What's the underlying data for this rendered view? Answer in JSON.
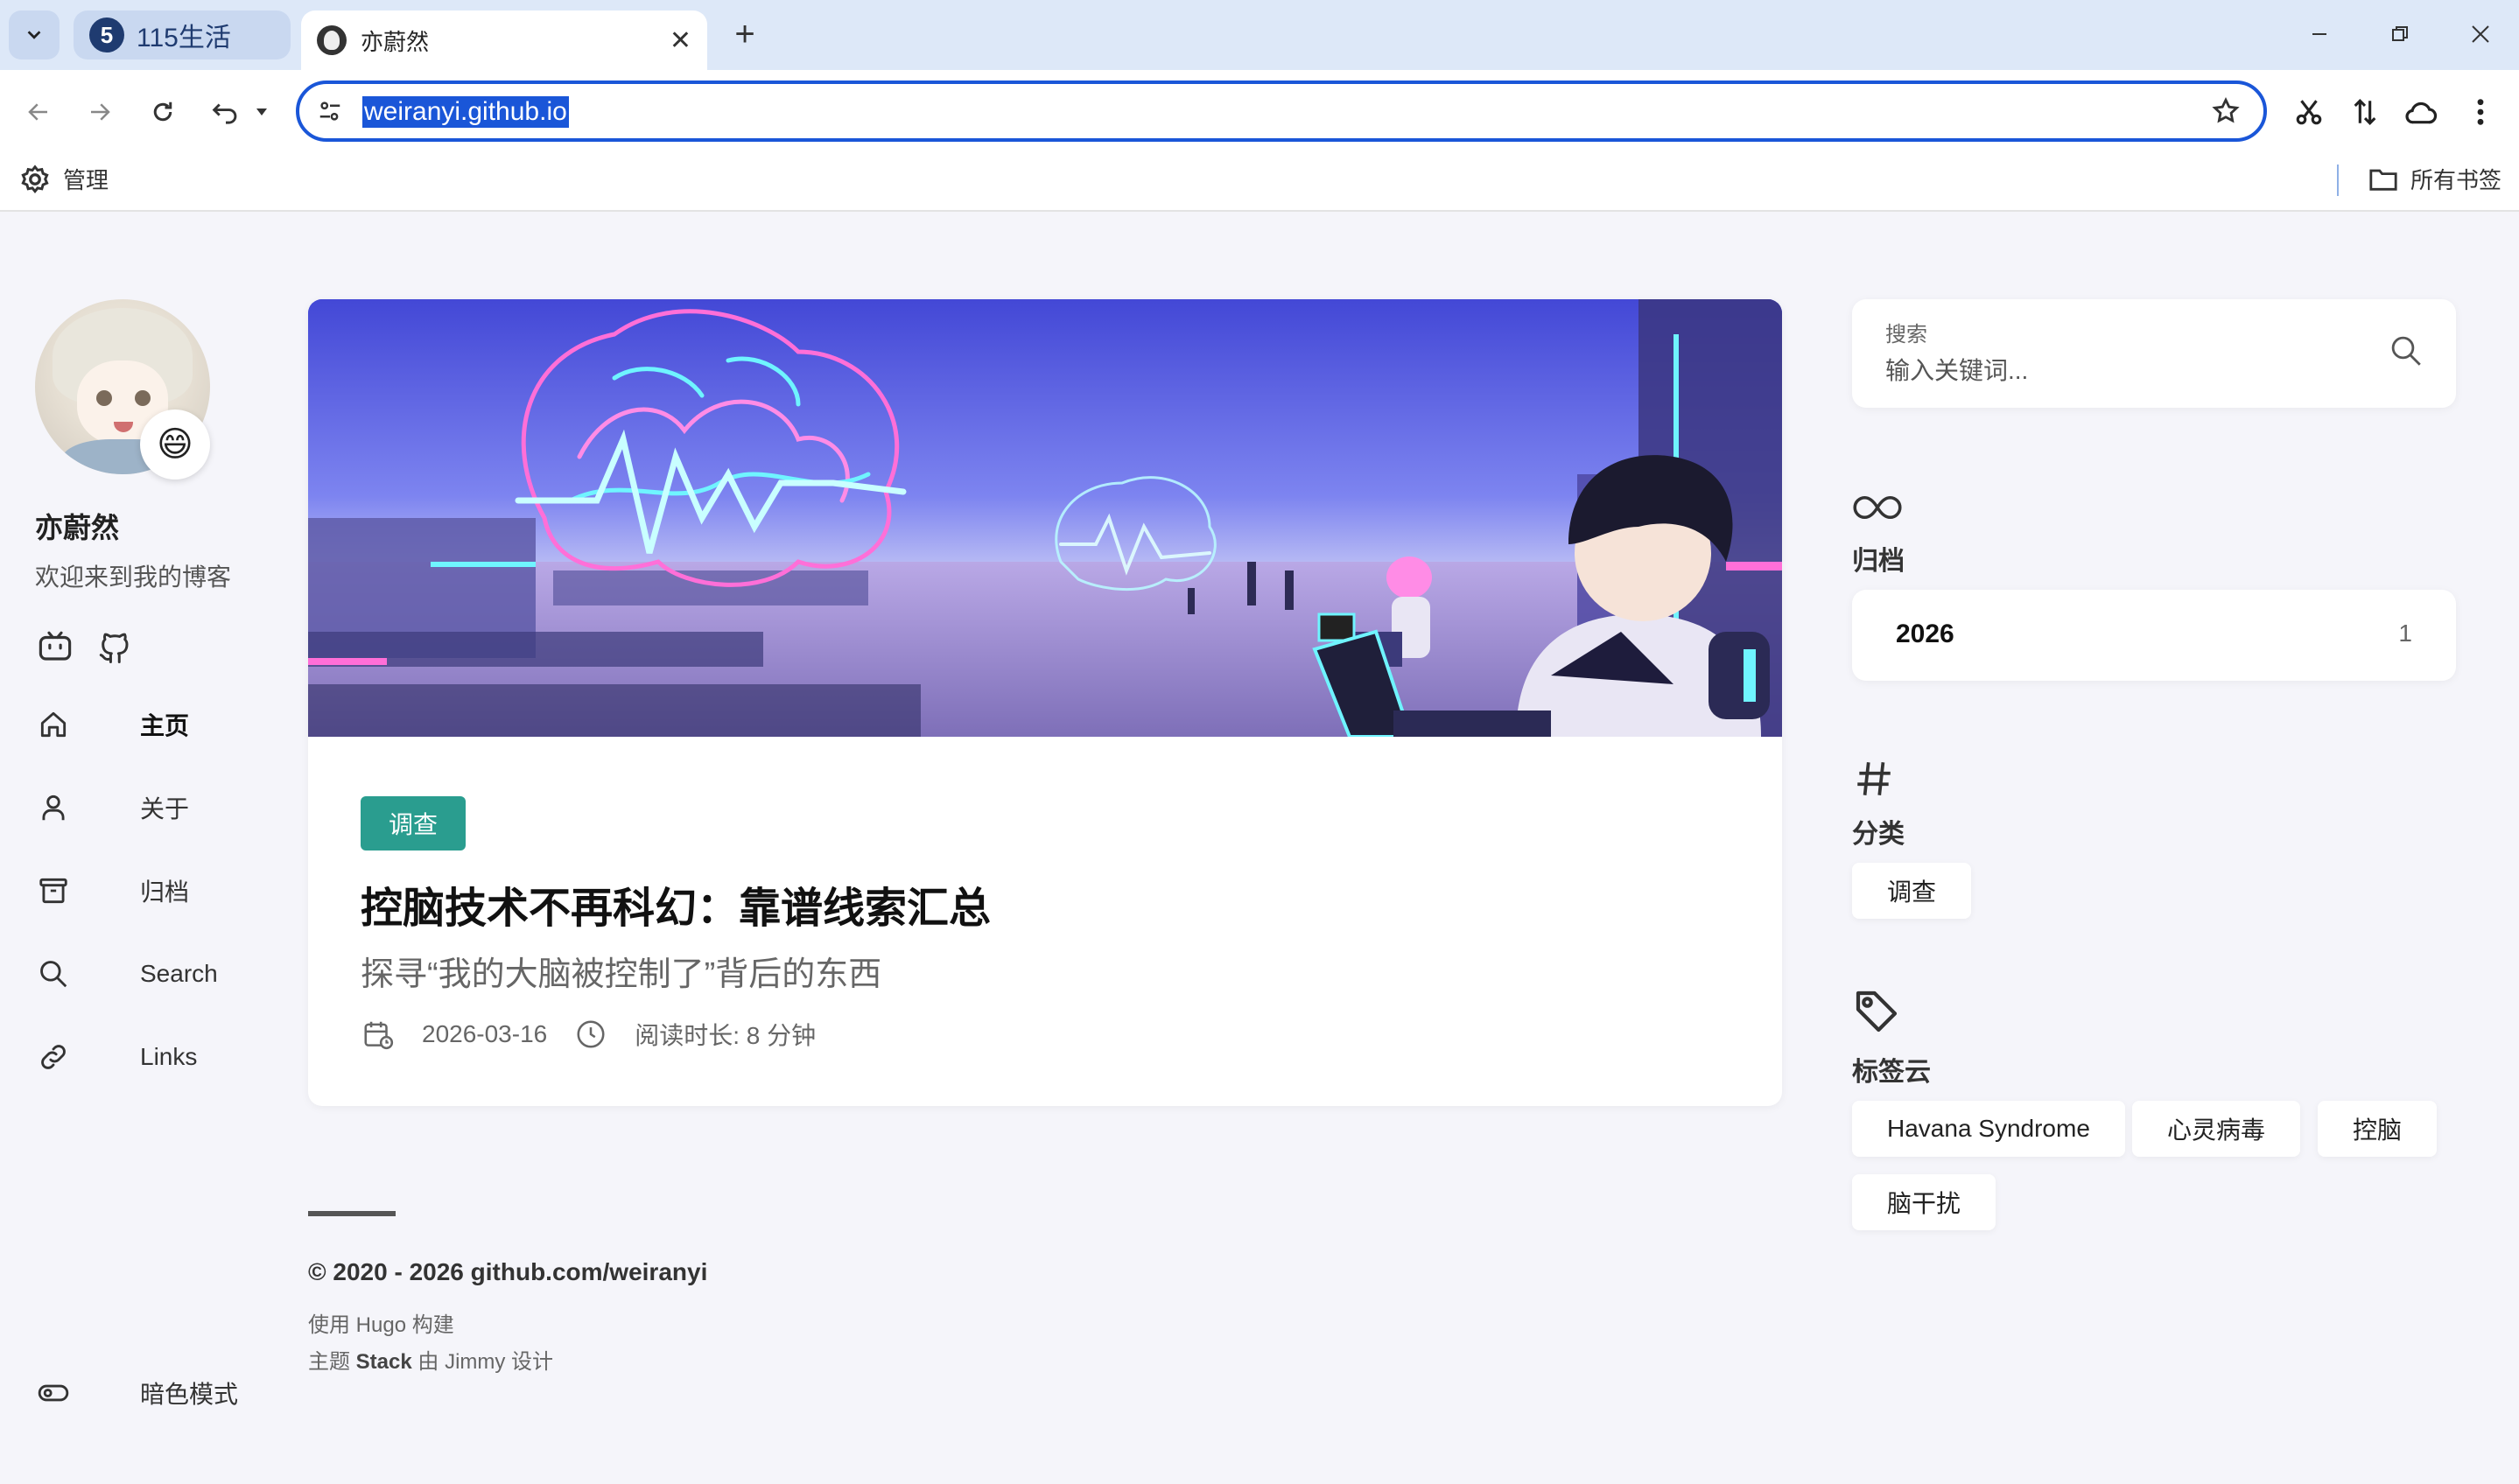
{
  "browser": {
    "tabs": [
      {
        "label": "115生活",
        "favicon": "5"
      },
      {
        "label": "亦蔚然"
      }
    ],
    "url": "weiranyi.github.io",
    "bookmarks": {
      "manage_label": "管理",
      "all_label": "所有书签"
    },
    "accent": "#1a56d8"
  },
  "profile": {
    "name": "亦蔚然",
    "description": "欢迎来到我的博客",
    "emoji": "😄"
  },
  "menu": [
    {
      "label": "主页",
      "icon": "home-icon",
      "active": true
    },
    {
      "label": "关于",
      "icon": "user-icon"
    },
    {
      "label": "归档",
      "icon": "archive-icon"
    },
    {
      "label": "Search",
      "icon": "search-icon"
    },
    {
      "label": "Links",
      "icon": "link-icon"
    }
  ],
  "dark_mode_label": "暗色模式",
  "post": {
    "category": "调查",
    "category_color": "#2a9d8f",
    "title": "控脑技术不再科幻：靠谱线索汇总",
    "subtitle": "探寻“我的大脑被控制了”背后的东西",
    "date": "2026-03-16",
    "read_time": "阅读时长: 8 分钟"
  },
  "footer": {
    "copyright": "© 2020 - 2026 github.com/weiranyi",
    "built_with_prefix": "使用 ",
    "built_with_name": "Hugo",
    "built_with_suffix": " 构建",
    "theme_prefix": "主题 ",
    "theme_name": "Stack",
    "theme_mid": " 由 ",
    "theme_author": "Jimmy",
    "theme_suffix": " 设计"
  },
  "sidebar": {
    "search": {
      "label": "搜索",
      "placeholder": "输入关键词..."
    },
    "archive": {
      "title": "归档",
      "year": "2026",
      "count": "1"
    },
    "categories": {
      "title": "分类",
      "items": [
        "调查"
      ]
    },
    "tags": {
      "title": "标签云",
      "items": [
        "Havana Syndrome",
        "心灵病毒",
        "控脑",
        "脑干扰"
      ]
    }
  }
}
